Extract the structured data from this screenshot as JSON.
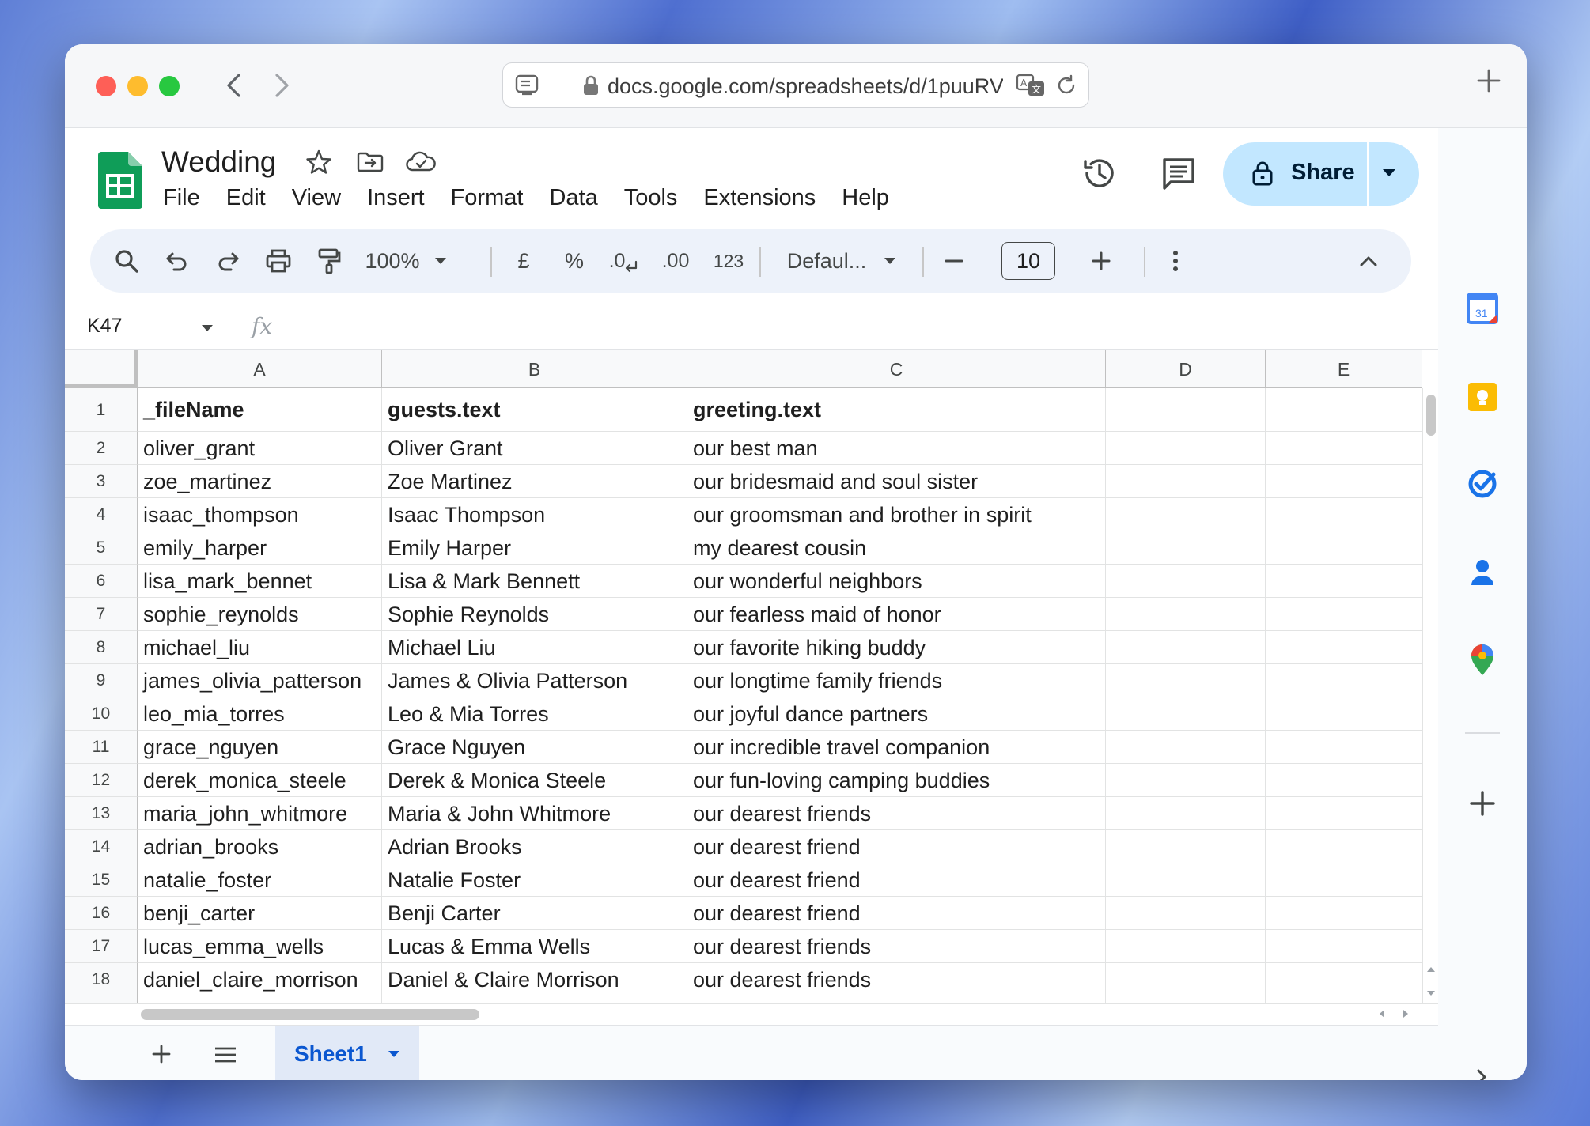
{
  "browser": {
    "url": "docs.google.com/spreadsheets/d/1puuRV"
  },
  "doc": {
    "title": "Wedding"
  },
  "menu": [
    "File",
    "Edit",
    "View",
    "Insert",
    "Format",
    "Data",
    "Tools",
    "Extensions",
    "Help"
  ],
  "share": {
    "label": "Share"
  },
  "toolbar": {
    "zoom": "100%",
    "currency": "£",
    "percent": "%",
    "decrease_decimal": ".0",
    "increase_decimal": ".00",
    "number_format": "123",
    "font": "Defaul...",
    "font_size": "10"
  },
  "formula_bar": {
    "name_box": "K47",
    "fx": "fx"
  },
  "columns": [
    "A",
    "B",
    "C",
    "D",
    "E"
  ],
  "rows": [
    {
      "num": "1",
      "a": "_fileName",
      "b": "guests.text",
      "c": "greeting.text"
    },
    {
      "num": "2",
      "a": "oliver_grant",
      "b": "Oliver Grant",
      "c": "our best man"
    },
    {
      "num": "3",
      "a": "zoe_martinez",
      "b": "Zoe Martinez",
      "c": "our bridesmaid and soul sister"
    },
    {
      "num": "4",
      "a": "isaac_thompson",
      "b": "Isaac Thompson",
      "c": "our groomsman and brother in spirit"
    },
    {
      "num": "5",
      "a": "emily_harper",
      "b": "Emily Harper",
      "c": "my dearest cousin"
    },
    {
      "num": "6",
      "a": "lisa_mark_bennet",
      "b": "Lisa & Mark Bennett",
      "c": "our wonderful neighbors"
    },
    {
      "num": "7",
      "a": "sophie_reynolds",
      "b": "Sophie Reynolds",
      "c": "our fearless maid of honor"
    },
    {
      "num": "8",
      "a": "michael_liu",
      "b": "Michael Liu",
      "c": "our favorite hiking buddy"
    },
    {
      "num": "9",
      "a": "james_olivia_patterson",
      "b": "James & Olivia Patterson",
      "c": "our longtime family friends"
    },
    {
      "num": "10",
      "a": "leo_mia_torres",
      "b": "Leo & Mia Torres",
      "c": "our joyful dance partners"
    },
    {
      "num": "11",
      "a": "grace_nguyen",
      "b": "Grace Nguyen",
      "c": "our incredible travel companion"
    },
    {
      "num": "12",
      "a": "derek_monica_steele",
      "b": "Derek & Monica Steele",
      "c": "our fun-loving camping buddies"
    },
    {
      "num": "13",
      "a": "maria_john_whitmore",
      "b": "Maria & John Whitmore",
      "c": "our dearest friends"
    },
    {
      "num": "14",
      "a": "adrian_brooks",
      "b": "Adrian Brooks",
      "c": "our dearest friend"
    },
    {
      "num": "15",
      "a": "natalie_foster",
      "b": "Natalie Foster",
      "c": "our dearest friend"
    },
    {
      "num": "16",
      "a": "benji_carter",
      "b": "Benji Carter",
      "c": "our dearest friend"
    },
    {
      "num": "17",
      "a": "lucas_emma_wells",
      "b": "Lucas & Emma Wells",
      "c": "our dearest friends"
    },
    {
      "num": "18",
      "a": "daniel_claire_morrison",
      "b": "Daniel & Claire Morrison",
      "c": "our dearest friends"
    }
  ],
  "sheet_tabs": [
    {
      "label": "Sheet1",
      "active": true
    }
  ],
  "side_panel": {
    "calendar_day": "31",
    "icons": [
      "calendar-icon",
      "keep-icon",
      "tasks-icon",
      "contacts-icon",
      "maps-icon",
      "add-icon"
    ]
  },
  "colors": {
    "share_bg": "#c2e7ff",
    "toolbar_bg": "#edf2fa",
    "sheet_tab_bg": "#e1e9f7",
    "sheet_tab_text": "#0b57d0",
    "sheets_green": "#0f9d58"
  }
}
